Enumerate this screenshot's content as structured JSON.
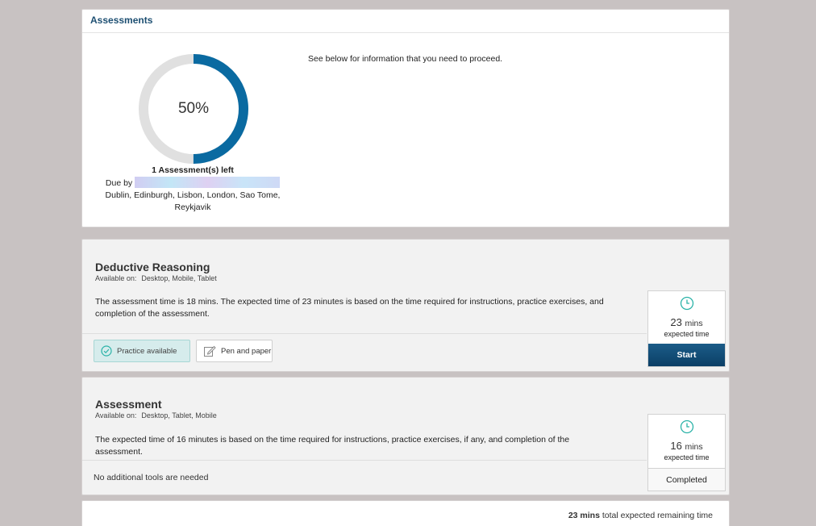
{
  "summary": {
    "title": "Assessments",
    "progress_text": "50%",
    "progress_fraction": 0.5,
    "assessments_left": "1 Assessment(s) left",
    "due_label": "Due by",
    "timezone": "Dublin, Edinburgh, Lisbon, London, Sao Tome, Reykjavik",
    "info": "See below for information that you need to proceed."
  },
  "colors": {
    "accent": "#0a6aa1",
    "ring_bg": "#e0e0e0",
    "teal": "#2bb3a8",
    "header_text": "#1d4f72"
  },
  "assessments": [
    {
      "title": "Deductive Reasoning",
      "available_label": "Available on:",
      "available_on": "Desktop, Mobile, Tablet",
      "description": "The assessment time is 18 mins. The expected time of 23 minutes is based on the time required for instructions, practice exercises, and completion of the assessment.",
      "tools": [
        {
          "label": "Practice available",
          "icon": "check-circle-icon"
        },
        {
          "label": "Pen and paper",
          "icon": "pencil-edit-icon"
        }
      ],
      "time_value": "23",
      "time_unit": "mins",
      "time_label": "expected time",
      "action_label": "Start"
    },
    {
      "title": "Assessment",
      "available_label": "Available on:",
      "available_on": "Desktop, Tablet, Mobile",
      "description": "The expected time of 16 minutes is based on the time required for instructions, practice exercises, if any, and completion of the assessment.",
      "no_tools": "No additional tools are needed",
      "time_value": "16",
      "time_unit": "mins",
      "time_label": "expected time",
      "status_label": "Completed"
    }
  ],
  "footer": {
    "total_value": "23 mins",
    "total_text": "total expected remaining time"
  }
}
